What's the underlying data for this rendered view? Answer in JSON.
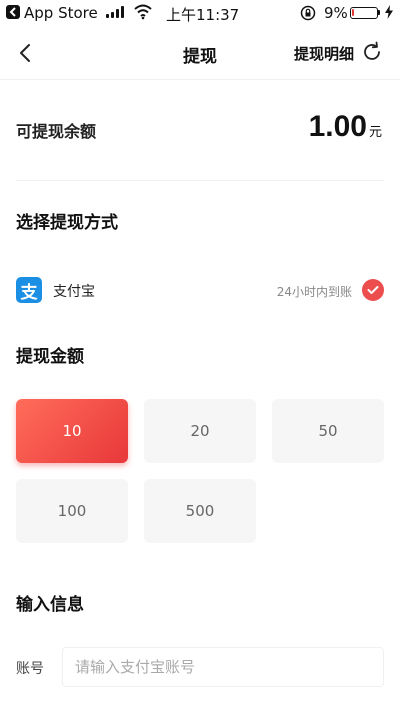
{
  "status_bar": {
    "app": "App Store",
    "time": "上午11:37",
    "battery": "9%",
    "battery_level": 0.09
  },
  "nav": {
    "title": "提现",
    "detail_link": "提现明细"
  },
  "balance": {
    "label": "可提现余额",
    "amount": "1.00",
    "unit": "元"
  },
  "method_section": {
    "title": "选择提现方式",
    "method": {
      "logo_text": "支",
      "name": "支付宝",
      "note": "24小时内到账",
      "selected": true
    }
  },
  "amount_section": {
    "title": "提现金额",
    "options": [
      "10",
      "20",
      "50",
      "100",
      "500"
    ],
    "selected": "10"
  },
  "info_section": {
    "title": "输入信息",
    "account_label": "账号",
    "account_placeholder": "请输入支付宝账号",
    "account_value": ""
  },
  "colors": {
    "accent": "#e8373a",
    "alipay": "#1a8fe3"
  }
}
